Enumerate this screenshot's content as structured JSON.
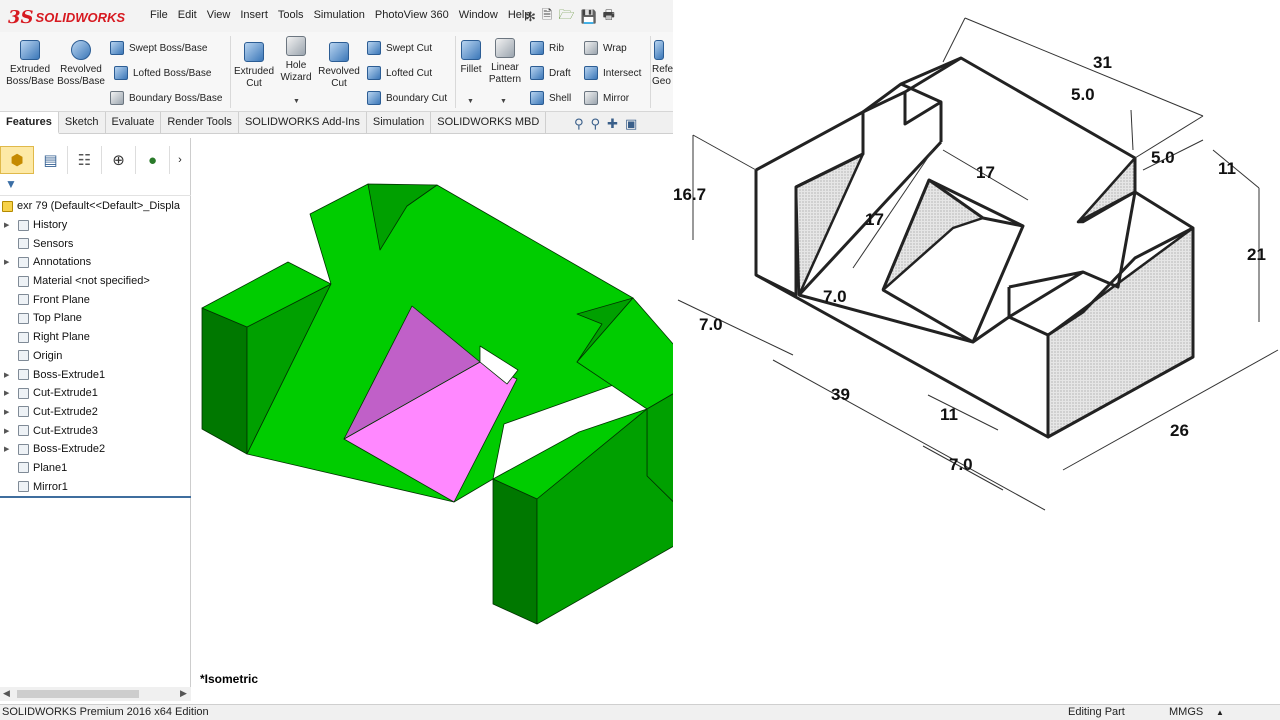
{
  "app": {
    "logo_prefix": "3S",
    "logo_text": "SOLIDWORKS",
    "menu": [
      "File",
      "Edit",
      "View",
      "Insert",
      "Tools",
      "Simulation",
      "PhotoView 360",
      "Window",
      "Help"
    ]
  },
  "ribbon": {
    "extruded_boss": "Extruded Boss/Base",
    "revolved_boss": "Revolved Boss/Base",
    "swept_boss": "Swept Boss/Base",
    "lofted_boss": "Lofted Boss/Base",
    "boundary_boss": "Boundary Boss/Base",
    "extruded_cut": "Extruded Cut",
    "hole_wizard": "Hole Wizard",
    "revolved_cut": "Revolved Cut",
    "swept_cut": "Swept Cut",
    "lofted_cut": "Lofted Cut",
    "boundary_cut": "Boundary Cut",
    "fillet": "Fillet",
    "linear_pattern": "Linear Pattern",
    "rib": "Rib",
    "draft": "Draft",
    "shell": "Shell",
    "wrap": "Wrap",
    "intersect": "Intersect",
    "mirror": "Mirror",
    "ref_geo": "Refe Geo"
  },
  "command_tabs": [
    "Features",
    "Sketch",
    "Evaluate",
    "Render Tools",
    "SOLIDWORKS Add-Ins",
    "Simulation",
    "SOLIDWORKS MBD"
  ],
  "feature_tree": {
    "root": "exr 79  (Default<<Default>_Displa",
    "items": [
      {
        "label": "History",
        "expandable": true
      },
      {
        "label": "Sensors",
        "expandable": false
      },
      {
        "label": "Annotations",
        "expandable": true
      },
      {
        "label": "Material <not specified>",
        "expandable": false
      },
      {
        "label": "Front Plane",
        "expandable": false
      },
      {
        "label": "Top Plane",
        "expandable": false
      },
      {
        "label": "Right Plane",
        "expandable": false
      },
      {
        "label": "Origin",
        "expandable": false
      },
      {
        "label": "Boss-Extrude1",
        "expandable": true
      },
      {
        "label": "Cut-Extrude1",
        "expandable": true
      },
      {
        "label": "Cut-Extrude2",
        "expandable": true
      },
      {
        "label": "Cut-Extrude3",
        "expandable": true
      },
      {
        "label": "Boss-Extrude2",
        "expandable": true
      },
      {
        "label": "Plane1",
        "expandable": false
      },
      {
        "label": "Mirror1",
        "expandable": false
      }
    ]
  },
  "viewport": {
    "view_label": "*Isometric",
    "model_colors": {
      "top": "#00cc00",
      "side": "#00a000",
      "dark": "#007800",
      "cut_light": "#ff88ff",
      "cut_dark": "#c060c8"
    }
  },
  "status": {
    "edition": "SOLIDWORKS Premium 2016 x64 Edition",
    "mode": "Editing Part",
    "units": "MMGS"
  },
  "drawing": {
    "dims": [
      "31",
      "5.0",
      "5.0",
      "11",
      "16.7",
      "17",
      "17",
      "21",
      "7.0",
      "7.0",
      "39",
      "11",
      "26",
      "7.0"
    ]
  }
}
